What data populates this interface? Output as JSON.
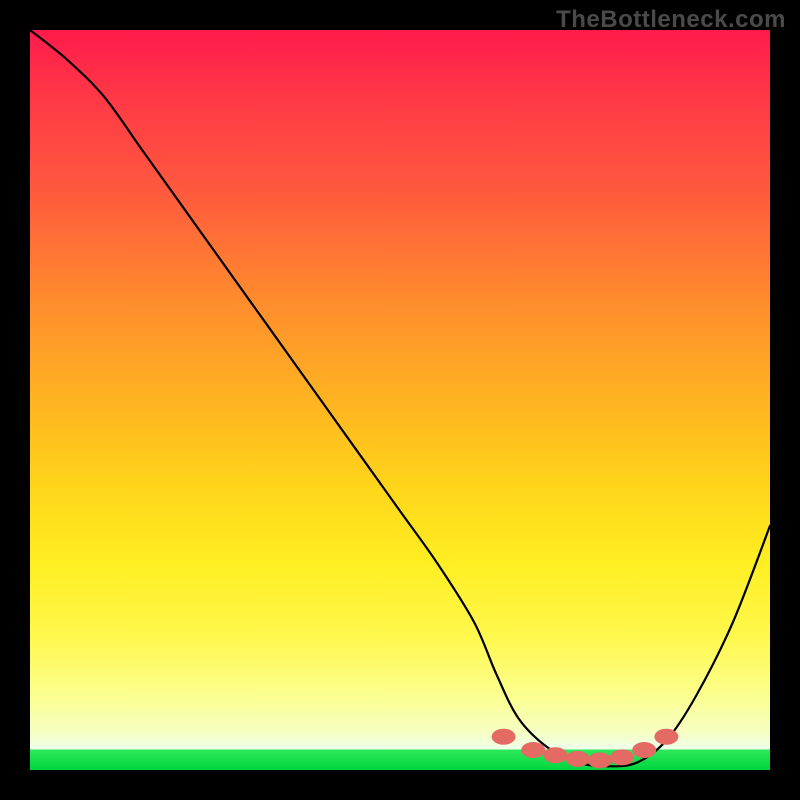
{
  "watermark": "TheBottleneck.com",
  "chart_data": {
    "type": "line",
    "title": "",
    "xlabel": "",
    "ylabel": "",
    "xlim": [
      0,
      100
    ],
    "ylim": [
      0,
      100
    ],
    "grid": false,
    "legend": false,
    "annotations": [],
    "series": [
      {
        "name": "bottleneck-curve",
        "x": [
          0,
          5,
          10,
          15,
          20,
          25,
          30,
          35,
          40,
          45,
          50,
          55,
          60,
          63,
          66,
          70,
          74,
          78,
          82,
          86,
          90,
          95,
          100
        ],
        "y": [
          100,
          96,
          91,
          84,
          77,
          70,
          63,
          56,
          49,
          42,
          35,
          28,
          20,
          13,
          7,
          3,
          1,
          0.5,
          1,
          4,
          10,
          20,
          33
        ]
      }
    ],
    "markers": [
      {
        "name": "sweet-spot-dot",
        "x": 64,
        "y": 4.5
      },
      {
        "name": "sweet-spot-dot",
        "x": 68,
        "y": 2.7
      },
      {
        "name": "sweet-spot-dot",
        "x": 71,
        "y": 2.0
      },
      {
        "name": "sweet-spot-dot",
        "x": 74,
        "y": 1.5
      },
      {
        "name": "sweet-spot-dot",
        "x": 77,
        "y": 1.3
      },
      {
        "name": "sweet-spot-dot",
        "x": 80,
        "y": 1.7
      },
      {
        "name": "sweet-spot-dot",
        "x": 83,
        "y": 2.7
      },
      {
        "name": "sweet-spot-dot",
        "x": 86,
        "y": 4.5
      }
    ],
    "background_gradient_meaning": "red=high-bottleneck, green=low-bottleneck"
  }
}
